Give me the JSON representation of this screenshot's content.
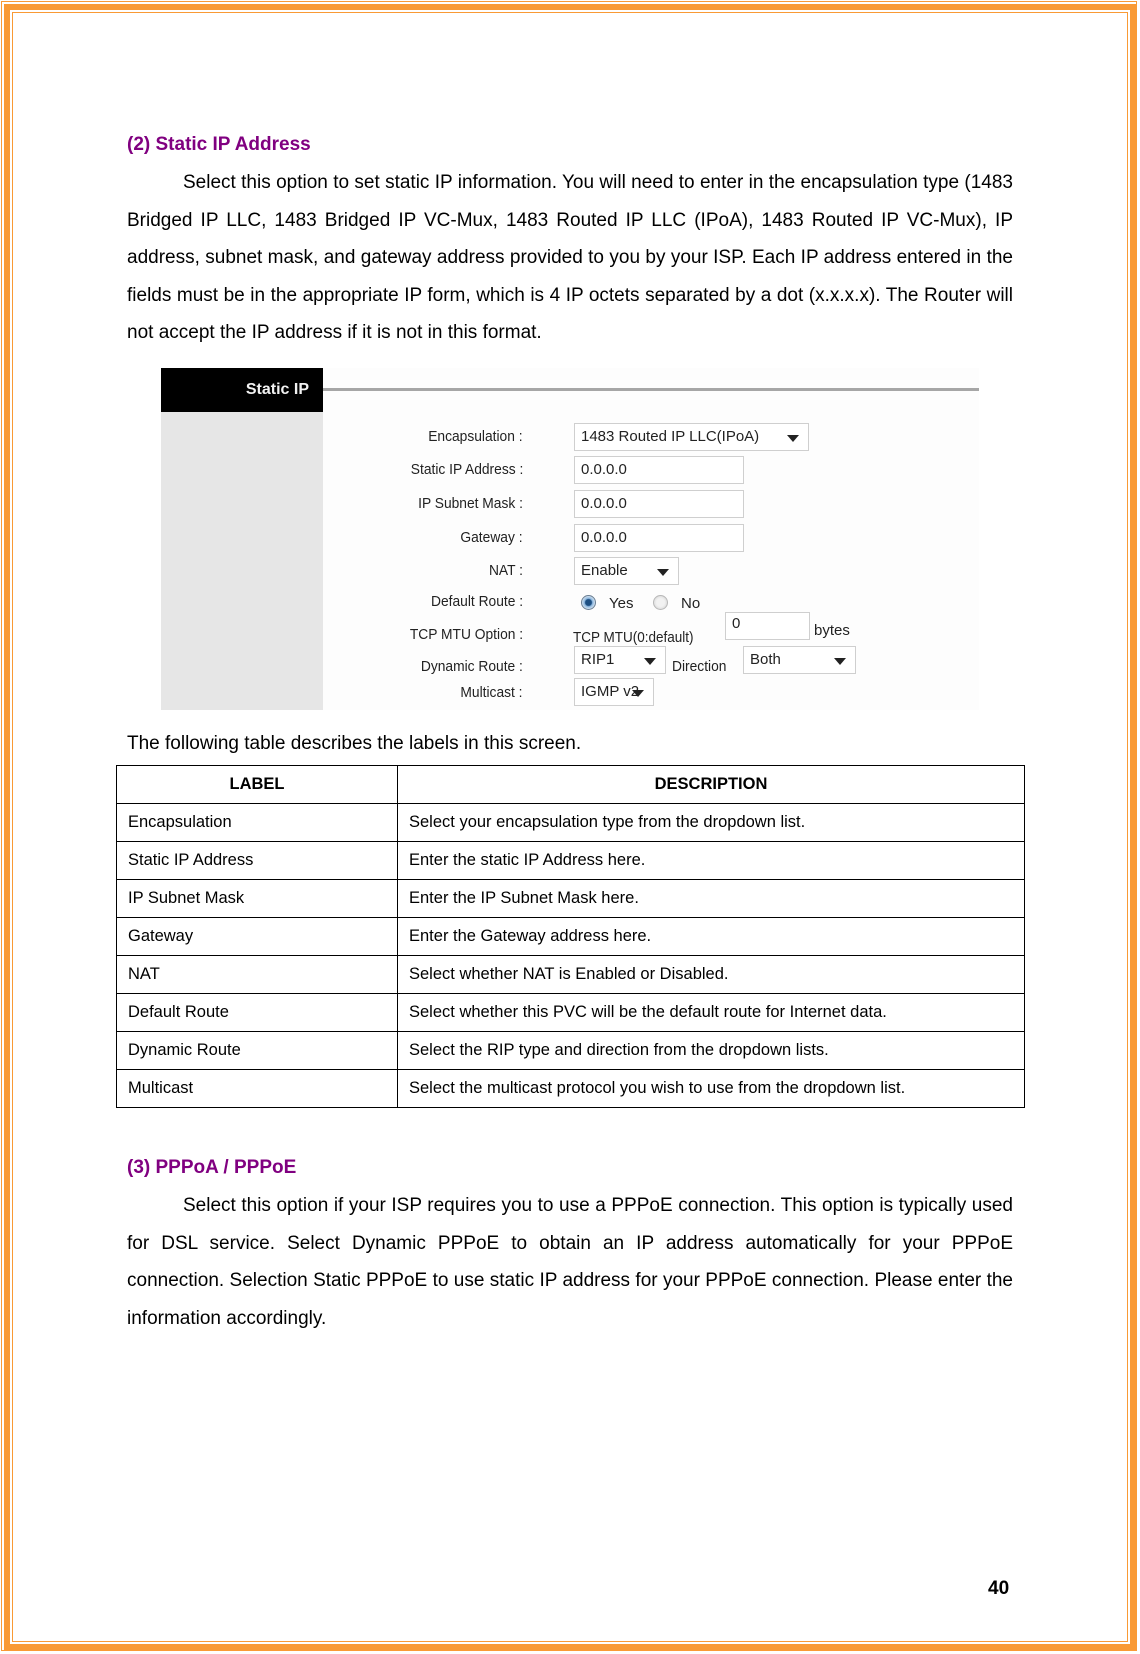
{
  "section2": {
    "heading": "(2) Static IP Address",
    "paragraph": "Select this option to set static IP information. You will need to enter in the encapsulation type (1483 Bridged IP LLC, 1483 Bridged IP VC-Mux, 1483 Routed IP LLC (IPoA), 1483 Routed IP VC-Mux), IP address, subnet mask, and gateway address provided to you by your ISP. Each IP address entered in the fields must be in the appropriate IP form, which is 4 IP octets separated by a dot (x.x.x.x). The Router will not accept the IP address if it is not in this format."
  },
  "screenshot": {
    "section_title": "Static IP",
    "encapsulation": {
      "label": "Encapsulation :",
      "value": "1483 Routed IP LLC(IPoA)"
    },
    "static_ip": {
      "label": "Static IP Address :",
      "value": "0.0.0.0"
    },
    "subnet_mask": {
      "label": "IP Subnet Mask :",
      "value": "0.0.0.0"
    },
    "gateway": {
      "label": "Gateway :",
      "value": "0.0.0.0"
    },
    "nat": {
      "label": "NAT :",
      "value": "Enable"
    },
    "default_route": {
      "label": "Default Route :",
      "yes": "Yes",
      "no": "No",
      "selected": "Yes"
    },
    "tcp_mtu": {
      "label": "TCP MTU Option :",
      "prefix": "TCP MTU(0:default)",
      "value": "0",
      "unit": "bytes"
    },
    "dynamic_route": {
      "label": "Dynamic Route :",
      "value": "RIP1",
      "direction_label": "Direction",
      "direction_value": "Both"
    },
    "multicast": {
      "label": "Multicast :",
      "value": "IGMP v2"
    }
  },
  "table": {
    "caption": "The following table describes the labels in this screen.",
    "headers": [
      "LABEL",
      "DESCRIPTION"
    ],
    "rows": [
      [
        "Encapsulation",
        "Select your encapsulation type from the dropdown list."
      ],
      [
        "Static IP Address",
        "Enter the static IP Address here."
      ],
      [
        "IP Subnet Mask",
        "Enter the IP Subnet Mask here."
      ],
      [
        "Gateway",
        "Enter the Gateway address here."
      ],
      [
        "NAT",
        "Select whether NAT is Enabled or Disabled."
      ],
      [
        "Default Route",
        "Select whether this PVC will be the default route for Internet data."
      ],
      [
        "Dynamic Route",
        "Select the RIP type and direction from the dropdown lists."
      ],
      [
        "Multicast",
        "Select the multicast protocol you wish to use from the dropdown list."
      ]
    ]
  },
  "section3": {
    "heading": "(3) PPPoA / PPPoE",
    "paragraph": "Select this option if your ISP requires you to use a PPPoE connection. This option is typically used for DSL service. Select Dynamic PPPoE to obtain an IP address automatically for your PPPoE connection. Selection Static PPPoE to use static IP address for your PPPoE connection. Please enter the information accordingly."
  },
  "page_number": "40",
  "colors": {
    "border": "#f99a35",
    "heading": "#800080"
  }
}
